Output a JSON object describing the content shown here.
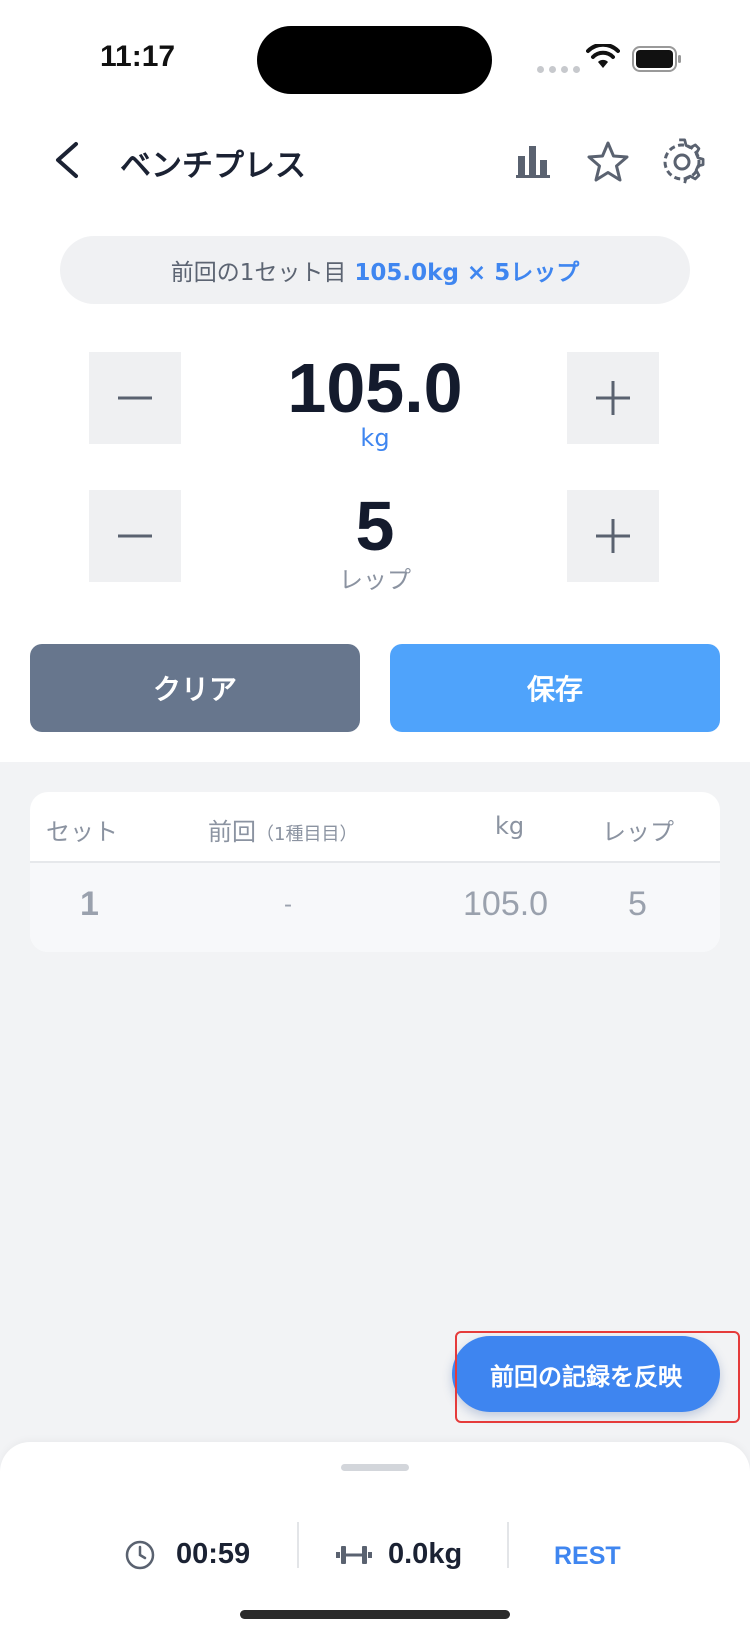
{
  "status": {
    "time": "11:17"
  },
  "nav": {
    "title": "ベンチプレス"
  },
  "previous_info": {
    "label": "前回の1セット目",
    "value": "105.0kg × 5レップ"
  },
  "weight": {
    "value": "105.0",
    "unit": "kg"
  },
  "reps": {
    "value": "5",
    "unit": "レップ"
  },
  "actions": {
    "clear_label": "クリア",
    "save_label": "保存"
  },
  "table": {
    "headers": {
      "set": "セット",
      "previous": "前回",
      "previous_sub": "（1種目目）",
      "kg": "kg",
      "reps": "レップ"
    },
    "rows": [
      {
        "set": "1",
        "previous": "-",
        "kg": "105.0",
        "reps": "5"
      }
    ]
  },
  "reflect_button": {
    "label": "前回の記録を反映"
  },
  "bottom_bar": {
    "timer": "00:59",
    "total_weight": "0.0kg",
    "rest_label": "REST"
  },
  "colors": {
    "accent": "#3f86f0",
    "save": "#4fa3fb",
    "clear": "#67768d",
    "highlight": "#e53b3b"
  }
}
